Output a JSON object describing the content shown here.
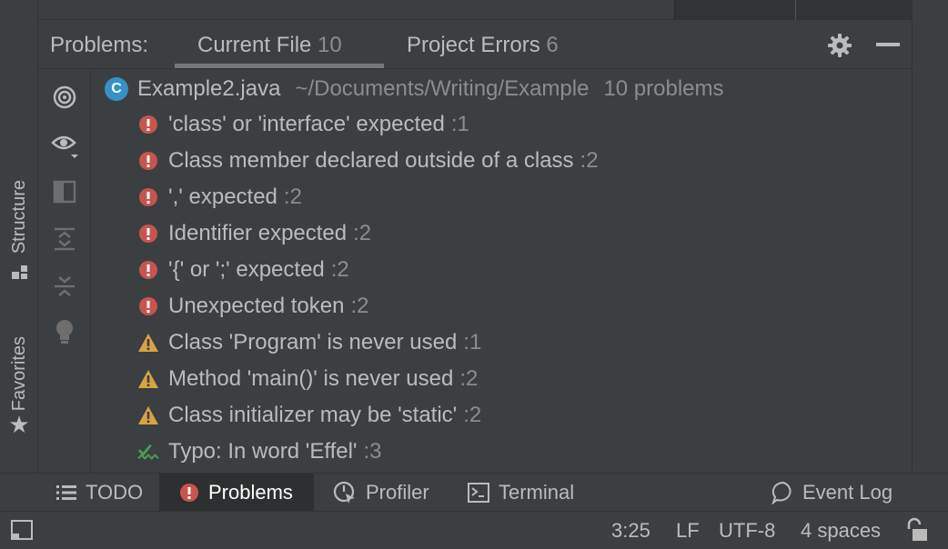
{
  "left_strip": {
    "structure_label": "Structure",
    "favorites_label": "Favorites"
  },
  "problems_header": {
    "title": "Problems:",
    "tabs": [
      {
        "label": "Current File",
        "count": "10"
      },
      {
        "label": "Project Errors",
        "count": "6"
      }
    ]
  },
  "file": {
    "icon_letter": "C",
    "name": "Example2.java",
    "path": "~/Documents/Writing/Example",
    "count_text": "10 problems"
  },
  "problems": [
    {
      "severity": "error",
      "message": "'class' or 'interface' expected",
      "line": ":1"
    },
    {
      "severity": "error",
      "message": "Class member declared outside of a class",
      "line": ":2"
    },
    {
      "severity": "error",
      "message": "',' expected",
      "line": ":2"
    },
    {
      "severity": "error",
      "message": "Identifier expected",
      "line": ":2"
    },
    {
      "severity": "error",
      "message": "'{' or ';' expected",
      "line": ":2"
    },
    {
      "severity": "error",
      "message": "Unexpected token",
      "line": ":2"
    },
    {
      "severity": "warning",
      "message": "Class 'Program' is never used",
      "line": ":1"
    },
    {
      "severity": "warning",
      "message": "Method 'main()' is never used",
      "line": ":2"
    },
    {
      "severity": "warning",
      "message": "Class initializer may be 'static'",
      "line": ":2"
    },
    {
      "severity": "typo",
      "message": "Typo: In word 'Effel'",
      "line": ":3"
    }
  ],
  "bottom_bar": {
    "todo": "TODO",
    "problems": "Problems",
    "profiler": "Profiler",
    "terminal": "Terminal",
    "event_log": "Event Log"
  },
  "status_bar": {
    "position": "3:25",
    "line_separator": "LF",
    "encoding": "UTF-8",
    "indent": "4 spaces"
  },
  "colors": {
    "background": "#3c3f41",
    "error": "#c75450",
    "warning": "#d9a343",
    "typo": "#499c54",
    "class_icon": "#3592c4"
  }
}
